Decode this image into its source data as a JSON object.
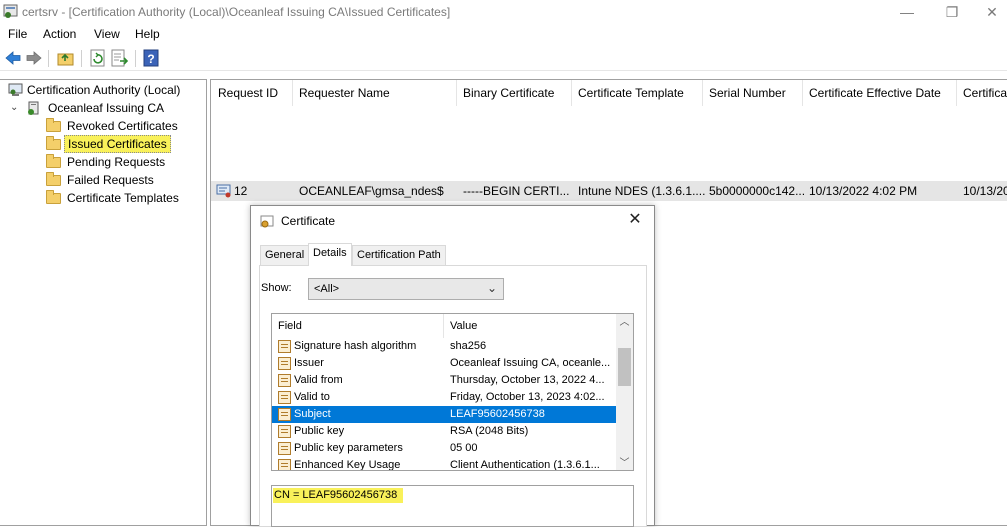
{
  "window": {
    "title": "certsrv - [Certification Authority (Local)\\Oceanleaf Issuing CA\\Issued Certificates]",
    "minimize": "—",
    "maximize": "❐",
    "close": "✕"
  },
  "menu": {
    "file": "File",
    "action": "Action",
    "view": "View",
    "help": "Help"
  },
  "tree": {
    "root": "Certification Authority (Local)",
    "ca": "Oceanleaf Issuing CA",
    "items": [
      "Revoked Certificates",
      "Issued Certificates",
      "Pending Requests",
      "Failed Requests",
      "Certificate Templates"
    ],
    "highlight_color": "#f9f15a"
  },
  "list": {
    "columns": [
      "Request ID",
      "Requester Name",
      "Binary Certificate",
      "Certificate Template",
      "Serial Number",
      "Certificate Effective Date",
      "Certifica"
    ],
    "rows": [
      [
        "12",
        "OCEANLEAF\\gmsa_ndes$",
        "-----BEGIN CERTI...",
        "Intune NDES (1.3.6.1....",
        "5b0000000c142...",
        "10/13/2022 4:02 PM",
        "10/13/20"
      ]
    ]
  },
  "dialog": {
    "title": "Certificate",
    "close": "✕",
    "tabs": [
      "General",
      "Details",
      "Certification Path"
    ],
    "active_tab": "Details",
    "show_label": "Show:",
    "show_value": "<All>",
    "field_header": "Field",
    "value_header": "Value",
    "fields": [
      {
        "field": "Signature hash algorithm",
        "value": "sha256"
      },
      {
        "field": "Issuer",
        "value": "Oceanleaf Issuing CA, oceanle..."
      },
      {
        "field": "Valid from",
        "value": "Thursday, October 13, 2022 4..."
      },
      {
        "field": "Valid to",
        "value": "Friday, October 13, 2023 4:02..."
      },
      {
        "field": "Subject",
        "value": "LEAF95602456738"
      },
      {
        "field": "Public key",
        "value": "RSA (2048 Bits)"
      },
      {
        "field": "Public key parameters",
        "value": "05 00"
      },
      {
        "field": "Enhanced Key Usage",
        "value": "Client Authentication (1.3.6.1..."
      }
    ],
    "selected_field": "Subject",
    "selection_color": "#0078d7",
    "value_text": "CN = LEAF95602456738",
    "value_highlight_color": "#f9f15a"
  }
}
